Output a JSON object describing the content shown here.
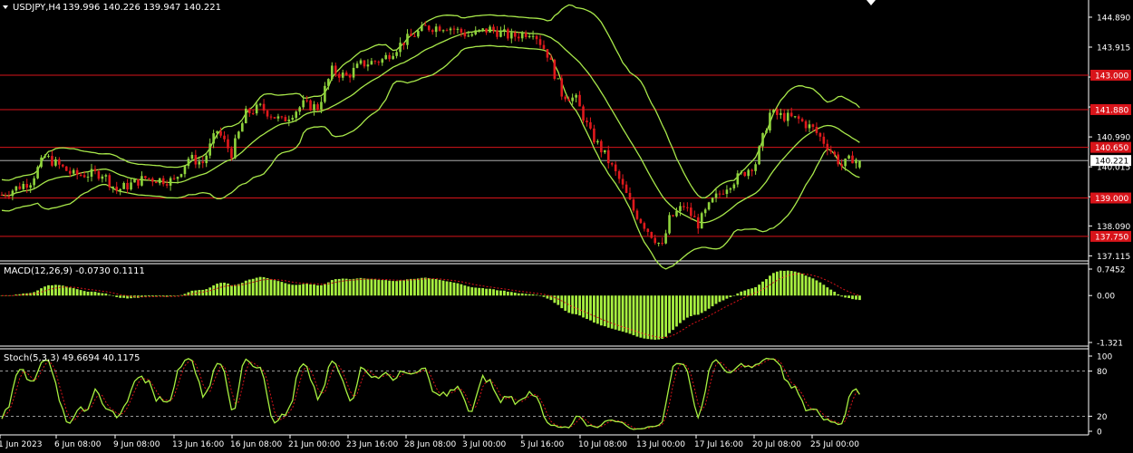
{
  "header": {
    "symbol": "USDJPY,H4",
    "ohlc": "139.996 140.226 139.947 140.221"
  },
  "colors": {
    "background": "#000000",
    "bull": "#8fd33c",
    "bear": "#e0191c",
    "bollinger": "#a8e84a",
    "level_line": "#d8141a",
    "macd_hist": "#a8f040",
    "macd_signal": "#d8141a",
    "stoch_main": "#a8f040",
    "stoch_signal": "#d8141a",
    "axis_text": "#ffffff",
    "current_price_line": "#c8c8c8"
  },
  "chart_data": [
    {
      "type": "line",
      "name": "price",
      "title": "USDJPY,H4",
      "ylim": [
        136.95,
        145.45
      ],
      "y_ticks": [
        "144.890",
        "143.915",
        "142.940",
        "141.965",
        "140.990",
        "140.015",
        "139.040",
        "138.090",
        "137.115"
      ],
      "x_ticks": [
        "1 Jun 2023",
        "6 Jun 08:00",
        "9 Jun 08:00",
        "13 Jun 16:00",
        "16 Jun 08:00",
        "21 Jun 00:00",
        "23 Jun 16:00",
        "28 Jun 08:00",
        "3 Jul 00:00",
        "5 Jul 16:00",
        "10 Jul 08:00",
        "13 Jul 00:00",
        "17 Jul 16:00",
        "20 Jul 08:00",
        "25 Jul 00:00"
      ],
      "levels": [
        {
          "value": 143.0,
          "label": "143.000"
        },
        {
          "value": 141.88,
          "label": "141.880"
        },
        {
          "value": 140.65,
          "label": "140.650"
        },
        {
          "value": 139.0,
          "label": "139.000"
        },
        {
          "value": 137.75,
          "label": "137.750"
        }
      ],
      "current_price": {
        "value": 140.221,
        "label": "140.221"
      },
      "series": [
        {
          "x": [
            0,
            1,
            2,
            3,
            4,
            5,
            6,
            7,
            8,
            9,
            10,
            11,
            12,
            13,
            14,
            15,
            16,
            17,
            18,
            19,
            20,
            21,
            22,
            23,
            24,
            25,
            26,
            27,
            28,
            29,
            30,
            31,
            32,
            33,
            34,
            35,
            36,
            37,
            38,
            39,
            40,
            41,
            42,
            43,
            44,
            45,
            46,
            47,
            48,
            49,
            50,
            51,
            52,
            53,
            54,
            55,
            56,
            57,
            58,
            59,
            60,
            61,
            62,
            63,
            64,
            65,
            66,
            67,
            68,
            69,
            70,
            71,
            72,
            73,
            74,
            75,
            76,
            77,
            78,
            79,
            80,
            81,
            82,
            83,
            84,
            85,
            86,
            87,
            88,
            89,
            90,
            91,
            92,
            93,
            94,
            95,
            96,
            97,
            98,
            99,
            100,
            101,
            102,
            103,
            104,
            105,
            106,
            107,
            108,
            109,
            110,
            111,
            112,
            113,
            114,
            115,
            116,
            117,
            118,
            119,
            120,
            121,
            122,
            123,
            124,
            125,
            126,
            127,
            128,
            129,
            130,
            131,
            132,
            133,
            134,
            135,
            136,
            137,
            138,
            139,
            140,
            141,
            142,
            143,
            144,
            145,
            146,
            147,
            148,
            149,
            150,
            151,
            152,
            153,
            154,
            155,
            156,
            157,
            158,
            159,
            160,
            161,
            162,
            163,
            164,
            165,
            166,
            167,
            168,
            169,
            170,
            171,
            172,
            173,
            174,
            175,
            176,
            177,
            178,
            179,
            180,
            181,
            182,
            183,
            184,
            185,
            186,
            187,
            188,
            189,
            190,
            191,
            192,
            193,
            194,
            195,
            196,
            197,
            198,
            199,
            200,
            201,
            202,
            203,
            204,
            205,
            206,
            207,
            208,
            209,
            210,
            211,
            212,
            213,
            214,
            215,
            216,
            217,
            218,
            219,
            220,
            221,
            222,
            223,
            224,
            225,
            226,
            227,
            228,
            229,
            230,
            231,
            232,
            233,
            234,
            235,
            236,
            237,
            238,
            239
          ]
        }
      ]
    },
    {
      "type": "bar",
      "name": "macd",
      "title": "MACD(12,26,9) -0.0730 0.1111",
      "ylim": [
        -1.321,
        0.7452
      ],
      "y_ticks": [
        "0.7452",
        "0.00",
        "-1.321"
      ]
    },
    {
      "type": "line",
      "name": "stochastic",
      "title": "Stoch(5,3,3) 49.6694 40.1175",
      "ylim": [
        0,
        100
      ],
      "y_ticks": [
        "100",
        "80",
        "20",
        "0"
      ],
      "levels": [
        80,
        20
      ]
    }
  ]
}
